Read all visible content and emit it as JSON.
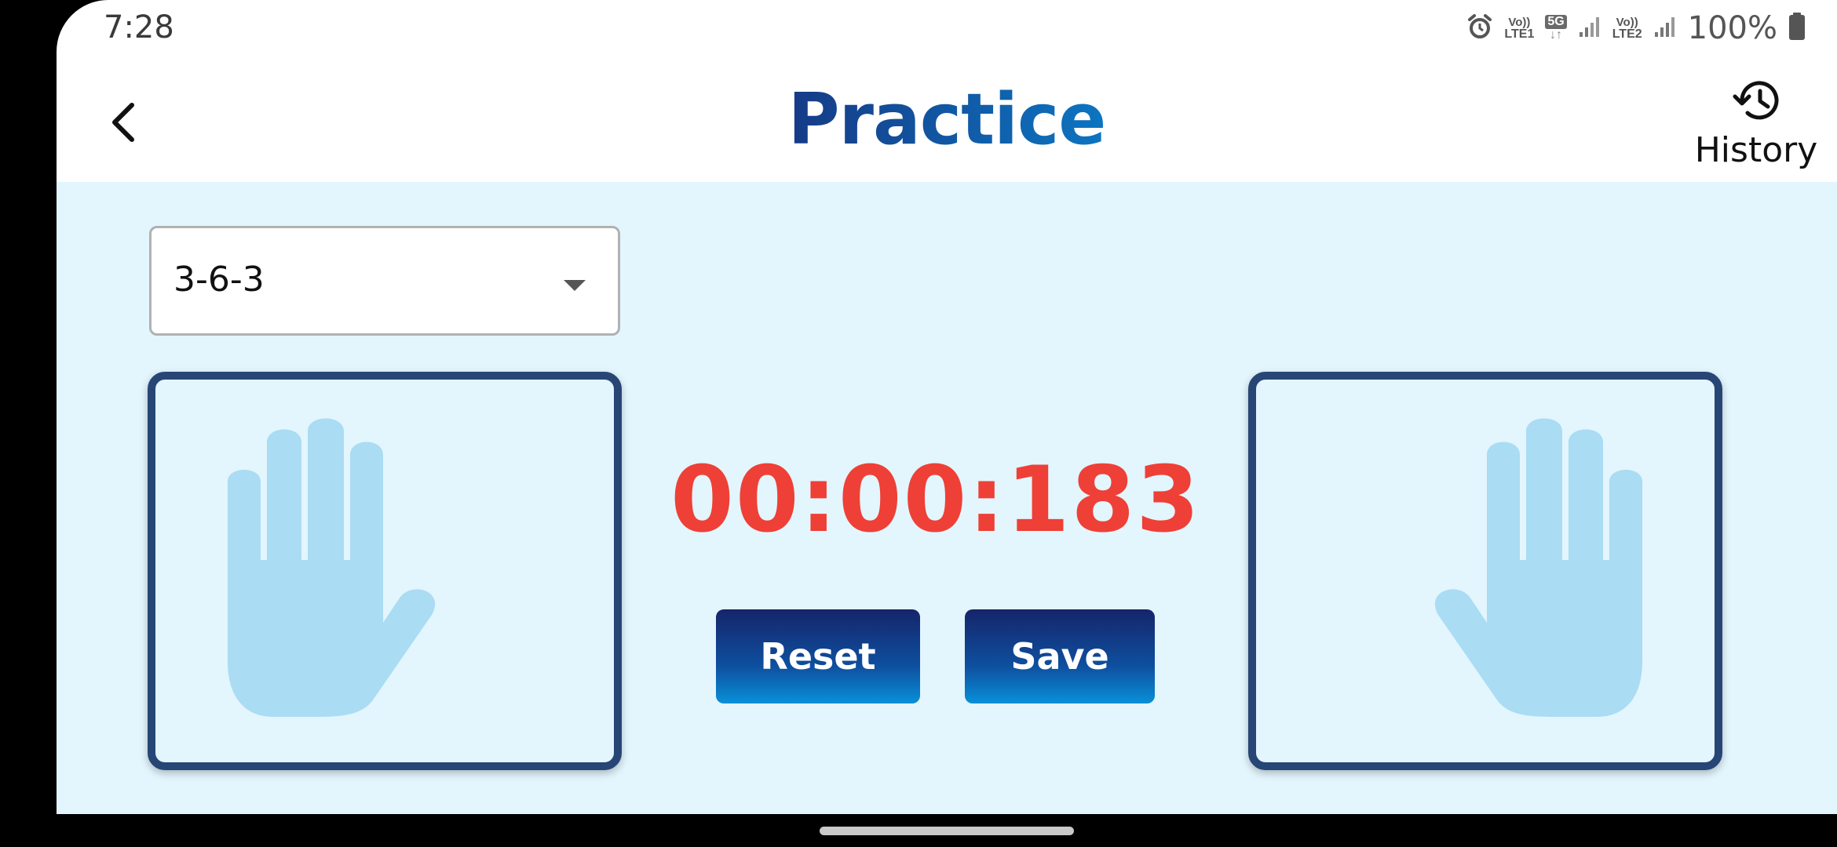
{
  "status_bar": {
    "time": "7:28",
    "sim1_top": "Vo))",
    "sim1_bottom": "LTE1",
    "network": "5G",
    "network_arrows": "↓↑",
    "sim2_top": "Vo))",
    "sim2_bottom": "LTE2",
    "battery": "100%",
    "icons": [
      "alarm-icon",
      "signal-icon",
      "signal-icon",
      "battery-icon"
    ]
  },
  "header": {
    "title": "Practice",
    "back_icon": "chevron-left-icon",
    "history_label": "History",
    "history_icon": "history-icon"
  },
  "pattern_select": {
    "selected": "3-6-3",
    "icon": "caret-down-icon"
  },
  "hands": {
    "left_icon": "hand-icon",
    "right_icon": "hand-icon",
    "color": "#aadcf3"
  },
  "timer": {
    "value": "00:00:183",
    "color": "#ee4036"
  },
  "actions": {
    "reset_label": "Reset",
    "save_label": "Save"
  },
  "colors": {
    "background": "#e3f5fd",
    "panel_border": "#274675",
    "button_top": "#15256a",
    "button_bottom": "#0890d8"
  }
}
